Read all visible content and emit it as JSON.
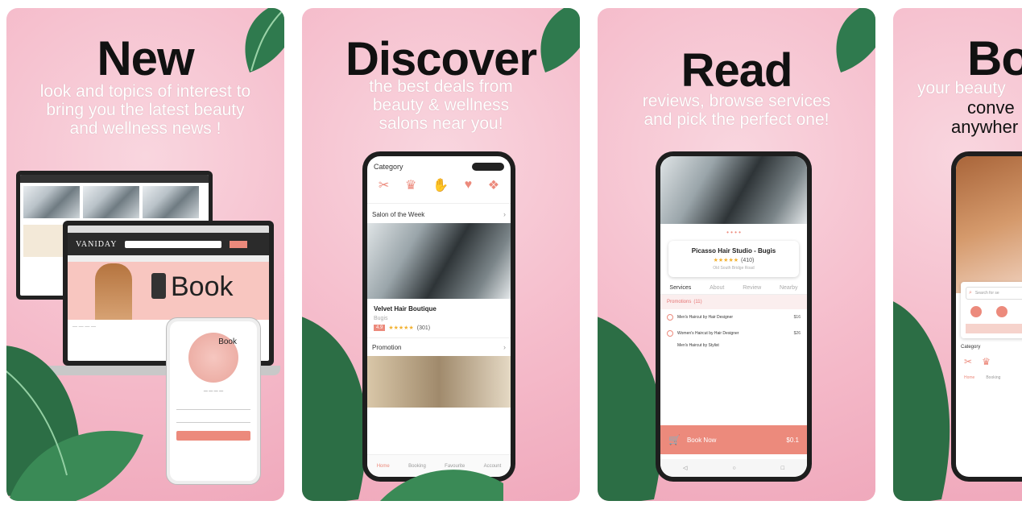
{
  "panels": [
    {
      "title": "New",
      "subtitle": [
        "look and topics of interest to",
        "bring you the latest beauty",
        "and wellness news !"
      ]
    },
    {
      "title": "Discover",
      "subtitle": [
        "the best deals from",
        "beauty & wellness",
        "salons near you!"
      ]
    },
    {
      "title": "Read",
      "subtitle": [
        "reviews, browse services",
        "and pick the perfect one!"
      ]
    },
    {
      "title": "Bo",
      "subtitle": [
        "your beauty",
        "conve",
        "anywher"
      ]
    }
  ],
  "web": {
    "logo": "VANIDAY",
    "hero_text": "Book",
    "phone_headline": "Book"
  },
  "discover_app": {
    "category_label": "Category",
    "salon_week_label": "Salon of the Week",
    "salon_name": "Velvet Hair Boutique",
    "salon_location": "Bugis",
    "rating_badge": "4.9",
    "rating_count": "(301)",
    "promotion_label": "Promotion",
    "nav": [
      "Home",
      "Booking",
      "Favourite",
      "Account"
    ]
  },
  "read_app": {
    "salon_name": "Picasso Hair Studio - Bugis",
    "rating_count": "(410)",
    "address": "Old South Bridge Road",
    "tabs": [
      "Services",
      "About",
      "Review",
      "Nearby"
    ],
    "promotions_label": "Promotions",
    "promotions_count": "(11)",
    "services": [
      {
        "name": "Men's Haircut by Hair Designer",
        "price": "$16"
      },
      {
        "name": "Women's Haircut by Hair Designer",
        "price": "$26"
      },
      {
        "name": "Men's Haircut by Stylist",
        "price": ""
      }
    ],
    "book_now": "Book Now",
    "book_price": "$0.1"
  },
  "book_app": {
    "search_placeholder": "Search for se",
    "category_label": "Category",
    "nav": [
      "Home",
      "Booking"
    ]
  },
  "colors": {
    "accent": "#ec8a7c",
    "bg_pink": "#f5bccb",
    "leaf": "#2f7a4e"
  }
}
